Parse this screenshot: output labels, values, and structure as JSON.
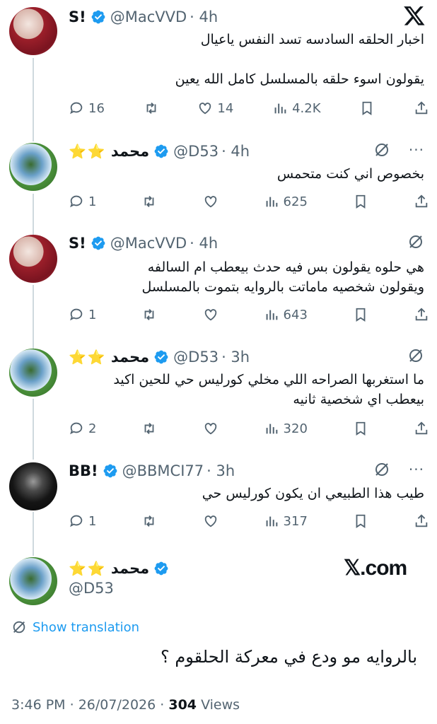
{
  "tweets": [
    {
      "name": "S!",
      "handle": "@MacVVD",
      "time": "· 4h",
      "lines": [
        "اخبار الحلقه السادسه تسد النفس ياعيال",
        "",
        "يقولون اسوء حلقه بالمسلسل كامل الله يعين"
      ],
      "replies": "16",
      "retweets": "",
      "likes": "14",
      "views": "4.2K"
    },
    {
      "name": "محمد",
      "stars": "⭐⭐",
      "handle": "@D53",
      "time": "· 4h",
      "lines": [
        "بخصوص اني كنت متحمس"
      ],
      "replies": "1",
      "retweets": "",
      "likes": "",
      "views": "625"
    },
    {
      "name": "S!",
      "handle": "@MacVVD",
      "time": "· 4h",
      "lines": [
        "هي حلوه يقولون بس فيه حدث بيعطب ام السالفه",
        "ويقولون شخصيه ماماتت بالروايه بتموت بالمسلسل"
      ],
      "replies": "1",
      "retweets": "",
      "likes": "",
      "views": "643"
    },
    {
      "name": "محمد",
      "stars": "⭐⭐",
      "handle": "@D53",
      "time": "· 3h",
      "lines": [
        "ما استغربها الصراحه اللي مخلي كورليس حي للحين اكيد",
        "بيعطب اي شخصية ثانيه"
      ],
      "replies": "2",
      "retweets": "",
      "likes": "",
      "views": "320"
    },
    {
      "name": "BB!",
      "handle": "@BBMCI77",
      "time": "· 3h",
      "lines": [
        "طيب هذا الطبيعي ان يكون كورليس حي"
      ],
      "replies": "1",
      "retweets": "",
      "likes": "",
      "views": "317"
    }
  ],
  "main": {
    "name": "محمد",
    "stars": "⭐⭐",
    "handle": "@D53",
    "brand": "𝕏.com",
    "show_translation": "Show translation",
    "text": "بالروايه مو ودع في معركة الحلقوم ؟",
    "time": "3:46 PM",
    "date": "26/07/2026",
    "views_count": "304",
    "views_label": "Views"
  },
  "colors": {
    "link": "#1d9bf0",
    "verified": "#1d9bf0",
    "muted": "#536471",
    "thread_line": "#cfd9de"
  },
  "icons": [
    "x-logo-icon",
    "verified-icon",
    "reply-icon",
    "retweet-icon",
    "like-icon",
    "views-icon",
    "bookmark-icon",
    "share-icon",
    "grok-icon",
    "more-icon",
    "translate-icon"
  ]
}
